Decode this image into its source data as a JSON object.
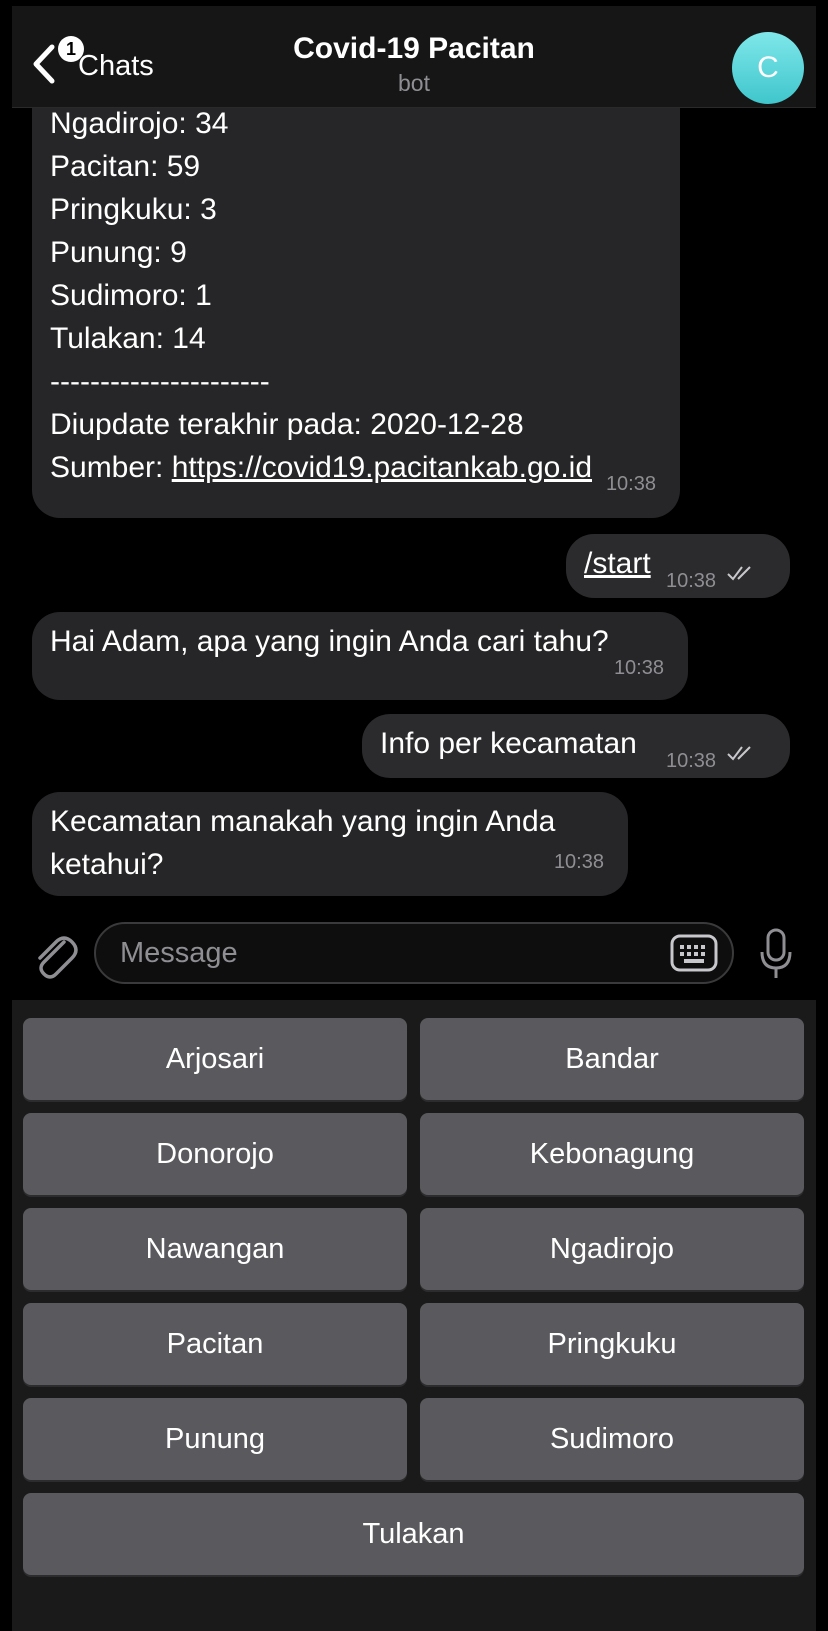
{
  "header": {
    "back_label": "Chats",
    "unread_count": "1",
    "title": "Covid-19 Pacitan",
    "subtitle": "bot",
    "avatar_initial": "C",
    "avatar_color": "#5ad4d9"
  },
  "messages": {
    "stats": {
      "lines": [
        "Ngadirojo: 34",
        "Pacitan: 59",
        "Pringkuku: 3",
        "Punung: 9",
        "Sudimoro: 1",
        "Tulakan: 14",
        "----------------------",
        "Diupdate terakhir pada: 2020-12-28"
      ],
      "source_prefix": "Sumber: ",
      "source_link": "https://covid19.pacitankab.go.id",
      "time": "10:38"
    },
    "start": {
      "text": "/start",
      "time": "10:38"
    },
    "greeting": {
      "text": "Hai Adam, apa yang ingin Anda cari tahu?",
      "time": "10:38"
    },
    "info": {
      "text": "Info per kecamatan",
      "time": "10:38"
    },
    "question": {
      "line1": "Kecamatan manakah yang ingin Anda",
      "line2": "ketahui?",
      "time": "10:38"
    }
  },
  "input": {
    "placeholder": "Message"
  },
  "keyboard": {
    "buttons": [
      "Arjosari",
      "Bandar",
      "Donorojo",
      "Kebonagung",
      "Nawangan",
      "Ngadirojo",
      "Pacitan",
      "Pringkuku",
      "Punung",
      "Sudimoro",
      "Tulakan"
    ]
  },
  "colors": {
    "incoming_bubble": "#262628",
    "keyboard_button": "#5a5a5e",
    "background": "#000000"
  }
}
